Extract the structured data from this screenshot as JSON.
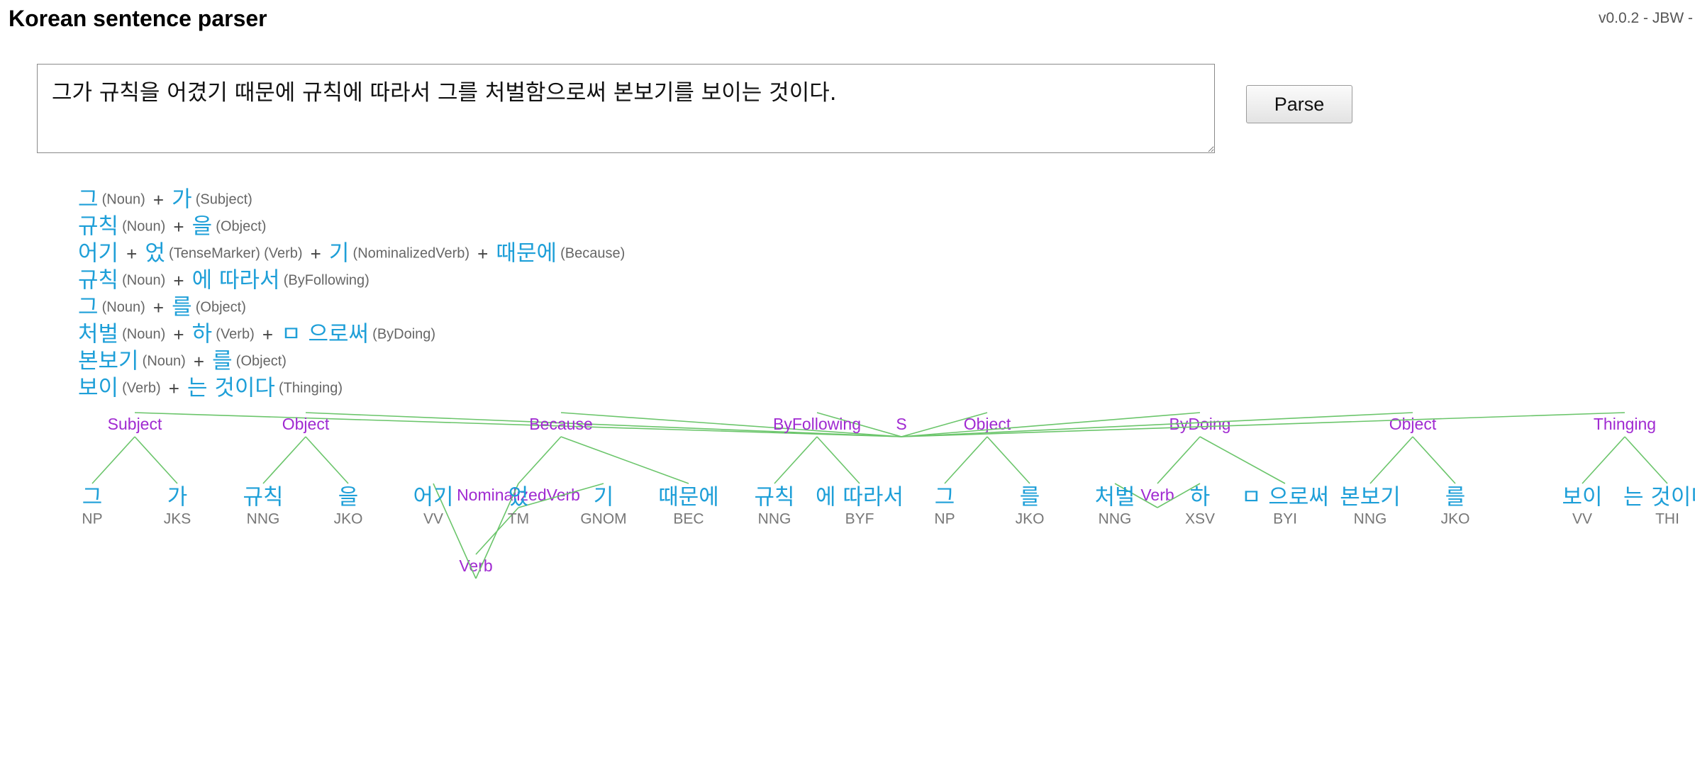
{
  "app": {
    "title": "Korean sentence parser",
    "version": "v0.0.2 - JBW -"
  },
  "input": {
    "sentence": "그가 규칙을 어겼기 때문에 규칙에 따라서 그를 처벌함으로써 본보기를 보이는 것이다."
  },
  "toolbar": {
    "parse_label": "Parse"
  },
  "morphemes": [
    [
      {
        "t": "그",
        "k": "tok"
      },
      {
        "t": "(Noun)",
        "k": "tag"
      },
      {
        "t": "+",
        "k": "plus"
      },
      {
        "t": "가",
        "k": "tok"
      },
      {
        "t": "(Subject)",
        "k": "tag"
      }
    ],
    [
      {
        "t": "규칙",
        "k": "tok"
      },
      {
        "t": "(Noun)",
        "k": "tag"
      },
      {
        "t": "+",
        "k": "plus"
      },
      {
        "t": "을",
        "k": "tok"
      },
      {
        "t": "(Object)",
        "k": "tag"
      }
    ],
    [
      {
        "t": "어기",
        "k": "tok"
      },
      {
        "t": "+",
        "k": "plus"
      },
      {
        "t": "었",
        "k": "tok"
      },
      {
        "t": "(TenseMarker)",
        "k": "tag"
      },
      {
        "t": "(Verb)",
        "k": "tag"
      },
      {
        "t": "+",
        "k": "plus"
      },
      {
        "t": "기",
        "k": "tok"
      },
      {
        "t": "(NominalizedVerb)",
        "k": "tag"
      },
      {
        "t": "+",
        "k": "plus"
      },
      {
        "t": "때문에",
        "k": "tok"
      },
      {
        "t": "(Because)",
        "k": "tag"
      }
    ],
    [
      {
        "t": "규칙",
        "k": "tok"
      },
      {
        "t": "(Noun)",
        "k": "tag"
      },
      {
        "t": "+",
        "k": "plus"
      },
      {
        "t": "에 따라서",
        "k": "tok"
      },
      {
        "t": "(ByFollowing)",
        "k": "tag"
      }
    ],
    [
      {
        "t": "그",
        "k": "tok"
      },
      {
        "t": "(Noun)",
        "k": "tag"
      },
      {
        "t": "+",
        "k": "plus"
      },
      {
        "t": "를",
        "k": "tok"
      },
      {
        "t": "(Object)",
        "k": "tag"
      }
    ],
    [
      {
        "t": "처벌",
        "k": "tok"
      },
      {
        "t": "(Noun)",
        "k": "tag"
      },
      {
        "t": "+",
        "k": "plus"
      },
      {
        "t": "하",
        "k": "tok"
      },
      {
        "t": "(Verb)",
        "k": "tag"
      },
      {
        "t": "+",
        "k": "plus"
      },
      {
        "t": "ㅁ 으로써",
        "k": "tok"
      },
      {
        "t": "(ByDoing)",
        "k": "tag"
      }
    ],
    [
      {
        "t": "본보기",
        "k": "tok"
      },
      {
        "t": "(Noun)",
        "k": "tag"
      },
      {
        "t": "+",
        "k": "plus"
      },
      {
        "t": "를",
        "k": "tok"
      },
      {
        "t": "(Object)",
        "k": "tag"
      }
    ],
    [
      {
        "t": "보이",
        "k": "tok"
      },
      {
        "t": "(Verb)",
        "k": "tag"
      },
      {
        "t": "+",
        "k": "plus"
      },
      {
        "t": "는 것이다",
        "k": "tok"
      },
      {
        "t": "(Thinging)",
        "k": "tag"
      }
    ]
  ],
  "tree": {
    "label": "S",
    "children": [
      {
        "label": "Subject",
        "children": [
          {
            "word": "그",
            "pos": "NP"
          },
          {
            "word": "가",
            "pos": "JKS"
          }
        ]
      },
      {
        "label": "Object",
        "children": [
          {
            "word": "규칙",
            "pos": "NNG"
          },
          {
            "word": "을",
            "pos": "JKO"
          }
        ]
      },
      {
        "label": "Because",
        "children": [
          {
            "label": "NominalizedVerb",
            "children": [
              {
                "label": "Verb",
                "children": [
                  {
                    "word": "어기",
                    "pos": "VV"
                  },
                  {
                    "word": "었",
                    "pos": "TM"
                  }
                ]
              },
              {
                "word": "기",
                "pos": "GNOM"
              }
            ]
          },
          {
            "word": "때문에",
            "pos": "BEC"
          }
        ]
      },
      {
        "label": "ByFollowing",
        "children": [
          {
            "word": "규칙",
            "pos": "NNG"
          },
          {
            "word": "에 따라서",
            "pos": "BYF"
          }
        ]
      },
      {
        "label": "Object",
        "children": [
          {
            "word": "그",
            "pos": "NP"
          },
          {
            "word": "를",
            "pos": "JKO"
          }
        ]
      },
      {
        "label": "ByDoing",
        "children": [
          {
            "label": "Verb",
            "children": [
              {
                "word": "처벌",
                "pos": "NNG"
              },
              {
                "word": "하",
                "pos": "XSV"
              }
            ]
          },
          {
            "word": "ㅁ 으로써",
            "pos": "BYI"
          }
        ]
      },
      {
        "label": "Object",
        "children": [
          {
            "word": "본보기",
            "pos": "NNG"
          },
          {
            "word": "를",
            "pos": "JKO"
          }
        ]
      },
      {
        "label": "Thinging",
        "children": [
          {
            "word": "보이",
            "pos": "VV"
          },
          {
            "word": "는 것이다",
            "pos": "THI"
          }
        ]
      }
    ]
  },
  "colors": {
    "token": "#1e9fd8",
    "node": "#a02ad1",
    "edge": "#6bc56b",
    "pos": "#777777"
  }
}
